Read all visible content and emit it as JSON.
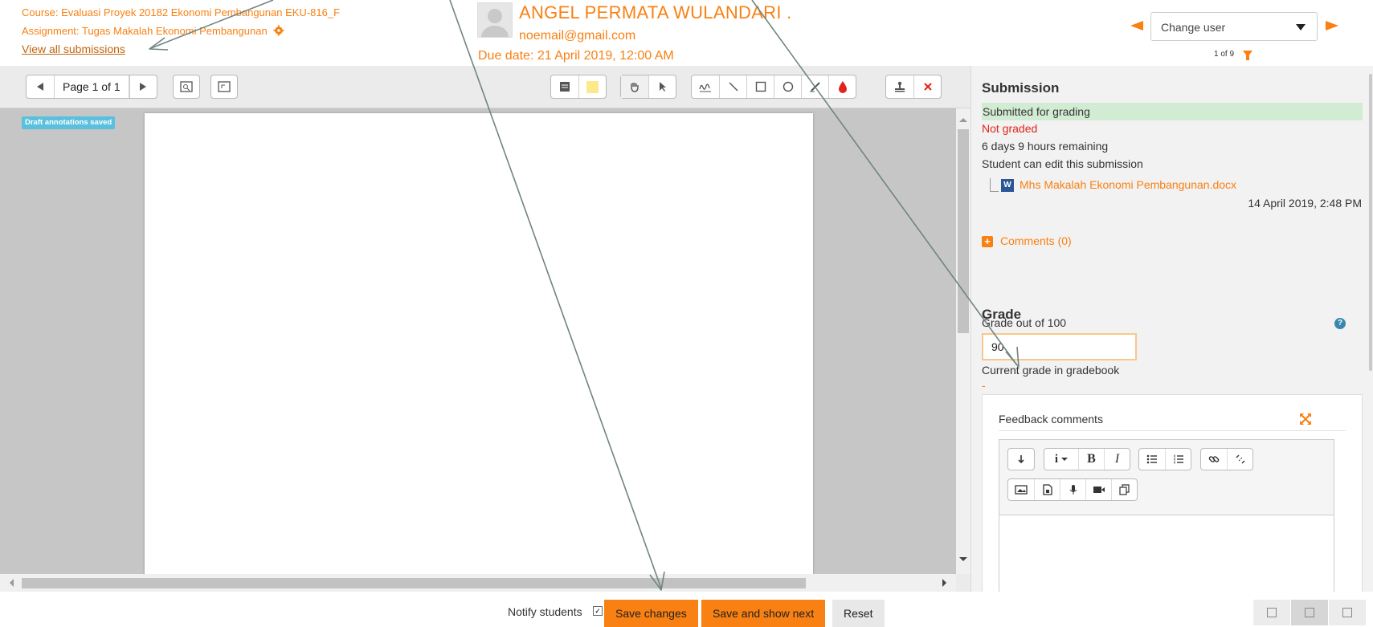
{
  "header": {
    "course": "Course: Evaluasi Proyek 20182 Ekonomi Pembangunan EKU-816_F",
    "assignment": "Assignment: Tugas Makalah Ekonomi Pembangunan",
    "view_all": "View all submissions",
    "user_name": "ANGEL PERMATA WULANDARI .",
    "user_email": "noemail@gmail.com",
    "due_date": "Due date: 21 April 2019, 12:00 AM",
    "change_user": "Change user",
    "user_count": "1 of 9"
  },
  "toolbar": {
    "page_label": "Page 1 of 1"
  },
  "editor": {
    "draft_badge": "Draft annotations saved"
  },
  "panel": {
    "submission_heading": "Submission",
    "status": "Submitted for grading",
    "grading_status": "Not graded",
    "time_remaining": "6 days 9 hours remaining",
    "edit_status": "Student can edit this submission",
    "file_name": "Mhs Makalah Ekonomi Pembangunan.docx",
    "file_date": "14 April 2019, 2:48 PM",
    "comments": "Comments (0)",
    "grade_heading": "Grade",
    "grade_label": "Grade out of 100",
    "grade_value": "90",
    "current_grade_label": "Current grade in gradebook",
    "current_grade_value": "-",
    "feedback_label": "Feedback comments"
  },
  "footer": {
    "notify_label": "Notify students",
    "save": "Save changes",
    "save_next": "Save and show next",
    "reset": "Reset"
  },
  "colors": {
    "accent": "#f98012",
    "submitted_bg": "#d2ecd4",
    "not_graded": "#e2231a",
    "badge": "#5bc0de",
    "arrow": "#6f8582"
  }
}
